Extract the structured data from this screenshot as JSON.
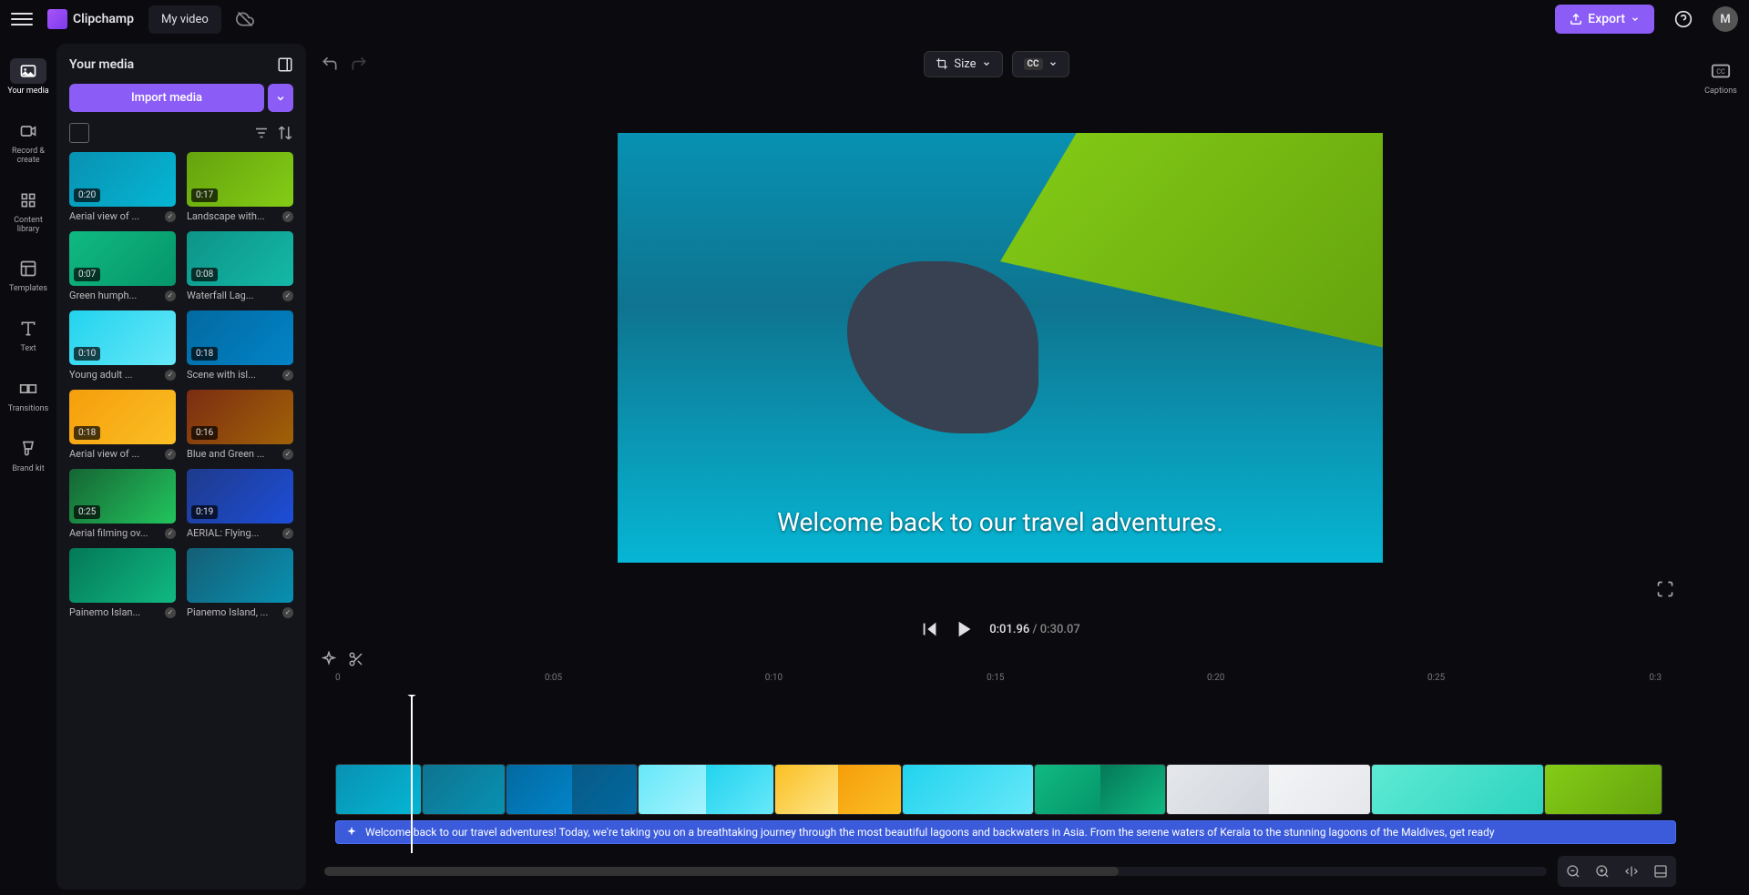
{
  "app": {
    "name": "Clipchamp",
    "projectName": "My video"
  },
  "topbar": {
    "exportLabel": "Export",
    "avatarInitial": "M"
  },
  "sidebar": {
    "items": [
      {
        "label": "Your media"
      },
      {
        "label": "Record & create"
      },
      {
        "label": "Content library"
      },
      {
        "label": "Templates"
      },
      {
        "label": "Text"
      },
      {
        "label": "Transitions"
      },
      {
        "label": "Brand kit"
      }
    ]
  },
  "mediaPanel": {
    "title": "Your media",
    "importLabel": "Import media",
    "items": [
      {
        "duration": "0:20",
        "title": "Aerial view of ..."
      },
      {
        "duration": "0:17",
        "title": "Landscape with..."
      },
      {
        "duration": "0:07",
        "title": "Green humph..."
      },
      {
        "duration": "0:08",
        "title": "Waterfall Lag..."
      },
      {
        "duration": "0:10",
        "title": "Young adult ..."
      },
      {
        "duration": "0:18",
        "title": "Scene with isl..."
      },
      {
        "duration": "0:18",
        "title": "Aerial view of ..."
      },
      {
        "duration": "0:16",
        "title": "Blue and Green ..."
      },
      {
        "duration": "0:25",
        "title": "Aerial filming ov..."
      },
      {
        "duration": "0:19",
        "title": "AERIAL: Flying..."
      },
      {
        "duration": "",
        "title": "Painemo Islan..."
      },
      {
        "duration": "",
        "title": "Pianemo Island, ..."
      }
    ]
  },
  "editorToolbar": {
    "sizeLabel": "Size",
    "ccLabel": "CC"
  },
  "preview": {
    "captionText": "Welcome back to our travel adventures."
  },
  "playback": {
    "currentTime": "0:01.96",
    "separator": " / ",
    "totalTime": "0:30.07"
  },
  "ruler": {
    "marks": [
      "0",
      "0:05",
      "0:10",
      "0:15",
      "0:20",
      "0:25",
      "0:3"
    ]
  },
  "audioTrack": {
    "text": "Welcome back to our travel adventures! Today, we're taking you on a breathtaking journey through the most beautiful lagoons and backwaters in Asia. From the serene waters of Kerala to the stunning lagoons of the Maldives, get ready"
  },
  "rightSidebar": {
    "captionsLabel": "Captions"
  }
}
